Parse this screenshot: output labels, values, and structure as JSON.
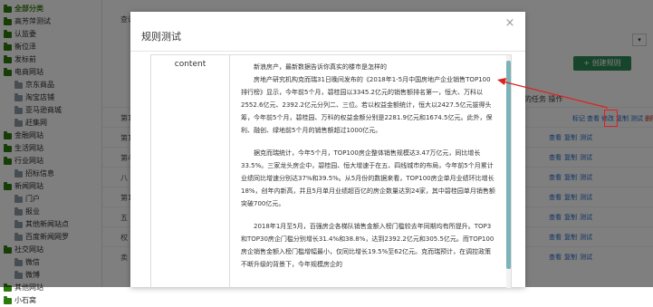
{
  "sidebar": {
    "items": [
      {
        "label": "全部分类",
        "level": 0,
        "root": true
      },
      {
        "label": "高芳萍测试",
        "level": 0
      },
      {
        "label": "认监委",
        "level": 0
      },
      {
        "label": "衡位泽",
        "level": 0
      },
      {
        "label": "发标前",
        "level": 0
      },
      {
        "label": "电商网站",
        "level": 0
      },
      {
        "label": "京东商品",
        "level": 1
      },
      {
        "label": "淘宝店铺",
        "level": 1
      },
      {
        "label": "亚马逊商城",
        "level": 1
      },
      {
        "label": "赶集网",
        "level": 1
      },
      {
        "label": "金融网站",
        "level": 0
      },
      {
        "label": "生活网站",
        "level": 0
      },
      {
        "label": "行业网站",
        "level": 0
      },
      {
        "label": "招标信息",
        "level": 1
      },
      {
        "label": "新闻网站",
        "level": 0
      },
      {
        "label": "门户",
        "level": 1
      },
      {
        "label": "报业",
        "level": 1
      },
      {
        "label": "其他新闻站点",
        "level": 1
      },
      {
        "label": "百度新闻网罗",
        "level": 1
      },
      {
        "label": "社交网站",
        "level": 0
      },
      {
        "label": "微信",
        "level": 1
      },
      {
        "label": "微博",
        "level": 1
      },
      {
        "label": "其他网站",
        "level": 0
      },
      {
        "label": "小石窝",
        "level": 0
      }
    ]
  },
  "background": {
    "query_label": "查询",
    "select_arrow": "▾",
    "create_button": "+ 创建规则",
    "columns_label": "的任务   操作",
    "rows": [
      {
        "name": "第1",
        "actions": [
          "标记",
          "查看",
          "修改",
          "复制",
          "测试",
          "删除"
        ]
      },
      {
        "name": "第1",
        "actions": [
          "查看",
          "复制",
          "测试"
        ]
      },
      {
        "name": "第4",
        "actions": [
          "查看",
          "复制",
          "测试"
        ]
      },
      {
        "name": "八",
        "actions": [
          "查看",
          "复制",
          "测试"
        ]
      },
      {
        "name": "第1",
        "actions": [
          "查看",
          "复制",
          "测试"
        ]
      },
      {
        "name": "五",
        "actions": [
          "查看",
          "复制",
          "测试"
        ]
      },
      {
        "name": "权",
        "actions": [
          "查看",
          "复制",
          "测试"
        ]
      },
      {
        "name": "卖",
        "actions": [
          "查看",
          "复制",
          "测试"
        ]
      }
    ]
  },
  "modal": {
    "title": "规则测试",
    "close_symbol": "×",
    "field_label": "content",
    "paragraphs": [
      "新浪房产，最新数据告诉你真实的楼市是怎样的",
      "房地产研究机构克而瑞31日晚间发布的《2018年1-5月中国房地产企业销售TOP100排行榜》显示，今年前5个月，碧桂园以3345.2亿元的销售额排名第一，恒大、万科以2552.6亿元、2392.2亿元分列二、三位。若以权益金额统计，恒大以2427.5亿元拔得头筹，今年前5个月，碧桂园、万科的权益金额分别是2281.9亿元和1674.5亿元。此外，保利、融创、绿地前5个月的销售额超过1000亿元。",
      "据克而瑞统计，今年5个月，TOP100房企整体销售规模达3.47万亿元，同比增长33.5%。三家龙头房企中，碧桂园、恒大增速于在五、四线城市的布局，今年前5个月累计业绩同比增速分别达37%和39.5%。从5月份的数据来看，TOP100房企单月业绩环比增长18%，创年内新高，并且5月单月业绩超百亿的房企数量达到24家，其中碧桂园单月销售额突破700亿元。",
      "2018年1月至5月，百强房企各梯队销售金额入榜门槛较去年同期均有所提升。TOP3和TOP30房企门槛分别增长31.4%和38.8%，达到2392.2亿元和305.5亿元。而TOP100房企销售金额入榜门槛增幅最小，仅同比增长19.5%至62亿元。克而瑞预计，在调控政策不断升级的背景下，今年规模房企的"
    ]
  },
  "side_actions": [
    "标记",
    "查看",
    "修改",
    "复制",
    "测试",
    "删除"
  ]
}
